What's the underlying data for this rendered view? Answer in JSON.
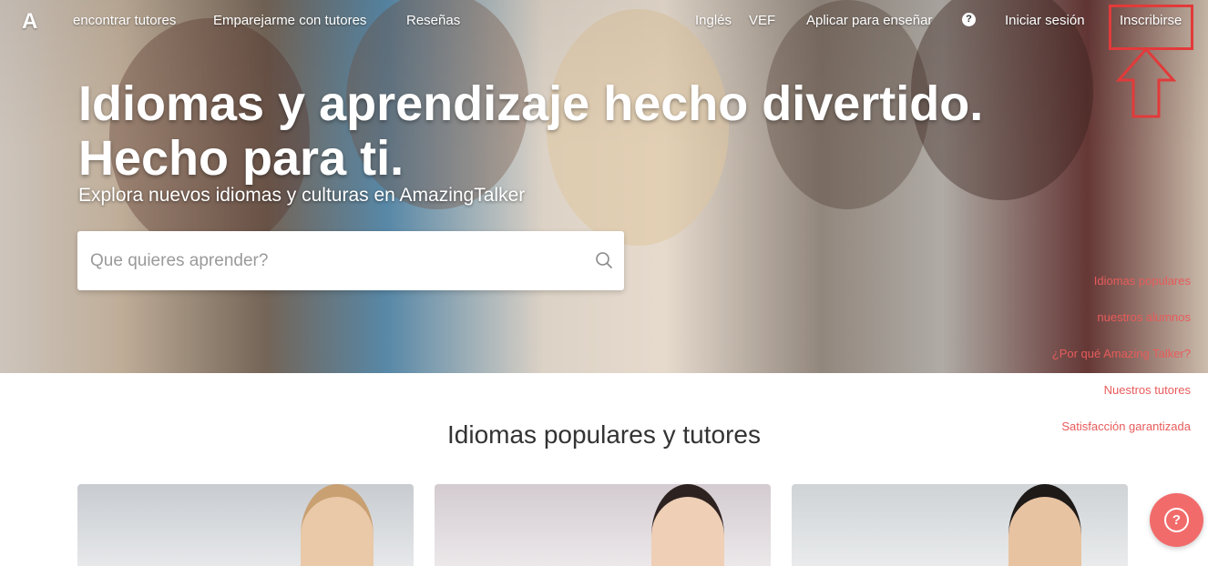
{
  "nav": {
    "logo": "A",
    "links": [
      "encontrar tutores",
      "Emparejarme con tutores",
      "Reseñas"
    ],
    "language": "Inglés",
    "currency": "VEF",
    "teach": "Aplicar para enseñar",
    "help": "?",
    "login": "Iniciar sesión",
    "signup": "Inscribirse"
  },
  "hero": {
    "title": "Idiomas y aprendizaje hecho divertido. Hecho para ti.",
    "subtitle": "Explora nuevos idiomas y culturas en AmazingTalker"
  },
  "search": {
    "placeholder": "Que quieres aprender?",
    "icon": "search-icon"
  },
  "side_nav": [
    "Idiomas populares",
    "nuestros alumnos",
    "¿Por qué Amazing Talker?",
    "Nuestros tutores",
    "Satisfacción garantizada"
  ],
  "section": {
    "title": "Idiomas populares y tutores"
  },
  "help_button": {
    "label": "?",
    "icon": "help-icon"
  },
  "colors": {
    "accent": "#e85b5b",
    "fab": "#f26b6b",
    "highlight": "#e23a3a"
  }
}
